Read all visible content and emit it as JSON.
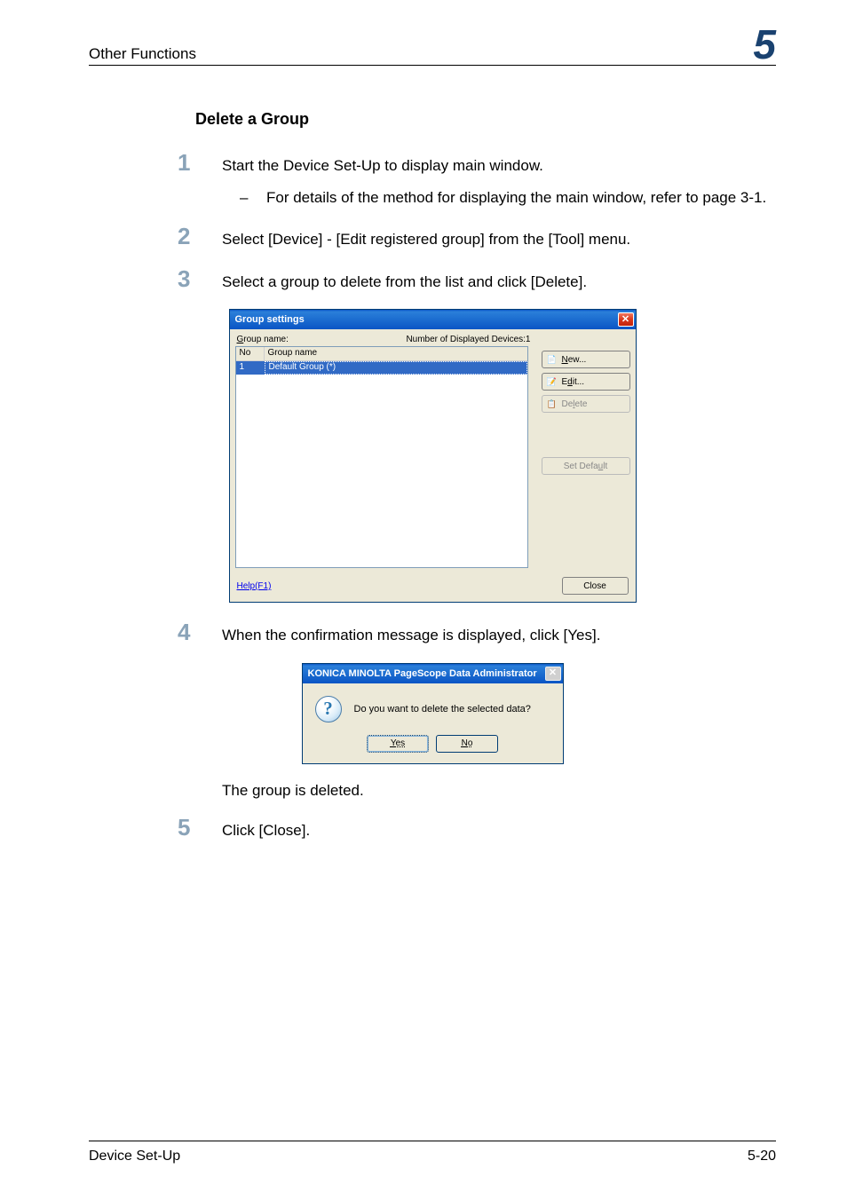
{
  "header": {
    "title": "Other Functions",
    "chapter": "5"
  },
  "section": {
    "title": "Delete a Group"
  },
  "steps": {
    "s1": {
      "num": "1",
      "text": "Start the Device Set-Up to display main window.",
      "sub": "For details of the method for displaying the main window, refer to page 3-1."
    },
    "s2": {
      "num": "2",
      "text": "Select [Device] - [Edit registered group] from the [Tool] menu."
    },
    "s3": {
      "num": "3",
      "text": "Select a group to delete from the list and click [Delete]."
    },
    "s4": {
      "num": "4",
      "text": "When the confirmation message is displayed, click [Yes]."
    },
    "s5": {
      "num": "5",
      "text": "Click [Close]."
    }
  },
  "group_window": {
    "title": "Group settings",
    "label_group_name": "Group name:",
    "label_num_devices": "Number of Displayed Devices:1",
    "col_no": "No",
    "col_name": "Group name",
    "row_no": "1",
    "row_name": "Default Group (*)",
    "btn_new": "New...",
    "btn_edit": "Edit...",
    "btn_delete": "Delete",
    "btn_set_default": "Set Default",
    "help": "Help(F1)",
    "close": "Close"
  },
  "confirm": {
    "title": "KONICA MINOLTA PageScope Data Administrator",
    "message": "Do you want to delete the selected data?",
    "yes": "Yes",
    "no": "No"
  },
  "result": "The group is deleted.",
  "footer": {
    "left": "Device Set-Up",
    "right": "5-20"
  }
}
